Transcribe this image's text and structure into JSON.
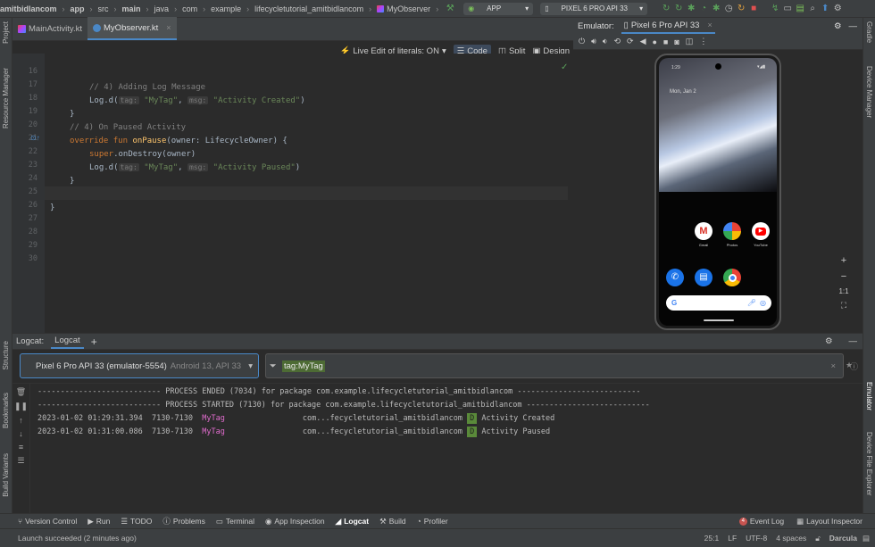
{
  "breadcrumb": [
    "amitbidlancom",
    "app",
    "src",
    "main",
    "java",
    "com",
    "example",
    "lifecycletutorial_amitbidlancom",
    "MyObserver"
  ],
  "run_config": "APP",
  "device_config": "PIXEL 6 PRO API 33",
  "editor_tabs": [
    {
      "label": "MainActivity.kt"
    },
    {
      "label": "MyObserver.kt"
    }
  ],
  "editor_toolbar": {
    "live_edit": "Live Edit of literals: ON",
    "code": "Code",
    "split": "Split",
    "design": "Design"
  },
  "line_numbers": [
    "16",
    "17",
    "18",
    "19",
    "20",
    "21",
    "22",
    "23",
    "24",
    "25",
    "26",
    "27",
    "28",
    "29",
    "30"
  ],
  "code": {
    "l17": "// 4) Adding Log Message",
    "l18_fn": "Log.d(",
    "l18_tag_hint": "tag:",
    "l18_tag": "\"MyTag\"",
    "l18_msg_hint": "msg:",
    "l18_msg": "\"Activity Created\"",
    "l19": "}",
    "l20": "// 4) On Paused Activity",
    "l21_kw": "override fun",
    "l21_fn": "onPause",
    "l21_rest": "(owner: LifecycleOwner) {",
    "l22_kw": "super",
    "l22_rest": ".onDestroy(owner)",
    "l23_fn": "Log.d(",
    "l23_tag_hint": "tag:",
    "l23_tag": "\"MyTag\"",
    "l23_msg_hint": "msg:",
    "l23_msg": "\"Activity Paused\"",
    "l24": "}",
    "l26": "}"
  },
  "emulator": {
    "label": "Emulator:",
    "device_tab": "Pixel 6 Pro API 33",
    "time": "1:29",
    "date": "Mon, Jan 2",
    "apps": [
      "Gmail",
      "Photos",
      "YouTube"
    ],
    "zoom_ratio": "1:1"
  },
  "logcat": {
    "label": "Logcat:",
    "tab": "Logcat",
    "device": "Pixel 6 Pro API 33 (emulator-5554)",
    "device_sub": "Android 13, API 33",
    "filter": "tag:MyTag",
    "lines": [
      {
        "text": "--------------------------- PROCESS ENDED (7034) for package com.example.lifecycletutorial_amitbidlancom ---------------------------"
      },
      {
        "text": "--------------------------- PROCESS STARTED (7130) for package com.example.lifecycletutorial_amitbidlancom ---------------------------"
      }
    ],
    "entries": [
      {
        "time": "2023-01-02 01:29:31.394",
        "pid": "7130-7130",
        "tag": "MyTag",
        "pkg": "com...fecycletutorial_amitbidlancom",
        "level": "D",
        "msg": "Activity Created"
      },
      {
        "time": "2023-01-02 01:31:00.086",
        "pid": "7130-7130",
        "tag": "MyTag",
        "pkg": "com...fecycletutorial_amitbidlancom",
        "level": "D",
        "msg": "Activity Paused"
      }
    ]
  },
  "left_strip": [
    "Project",
    "Resource Manager",
    "Structure",
    "Bookmarks",
    "Build Variants"
  ],
  "right_strip": [
    "Gradle",
    "Device Manager",
    "Emulator",
    "Device File Explorer"
  ],
  "bottom_tabs": [
    "Version Control",
    "Run",
    "TODO",
    "Problems",
    "Terminal",
    "App Inspection",
    "Logcat",
    "Build",
    "Profiler"
  ],
  "bottom_right": {
    "event_log": "Event Log",
    "event_count": "4",
    "layout_inspector": "Layout Inspector"
  },
  "status": {
    "message": "Launch succeeded (2 minutes ago)",
    "pos": "25:1",
    "lf": "LF",
    "enc": "UTF-8",
    "indent": "4 spaces",
    "theme": "Darcula"
  },
  "colors": {
    "accent": "#4a88c7",
    "tag_pink": "#e06ccd",
    "debug_badge": "#5a8a3a"
  }
}
